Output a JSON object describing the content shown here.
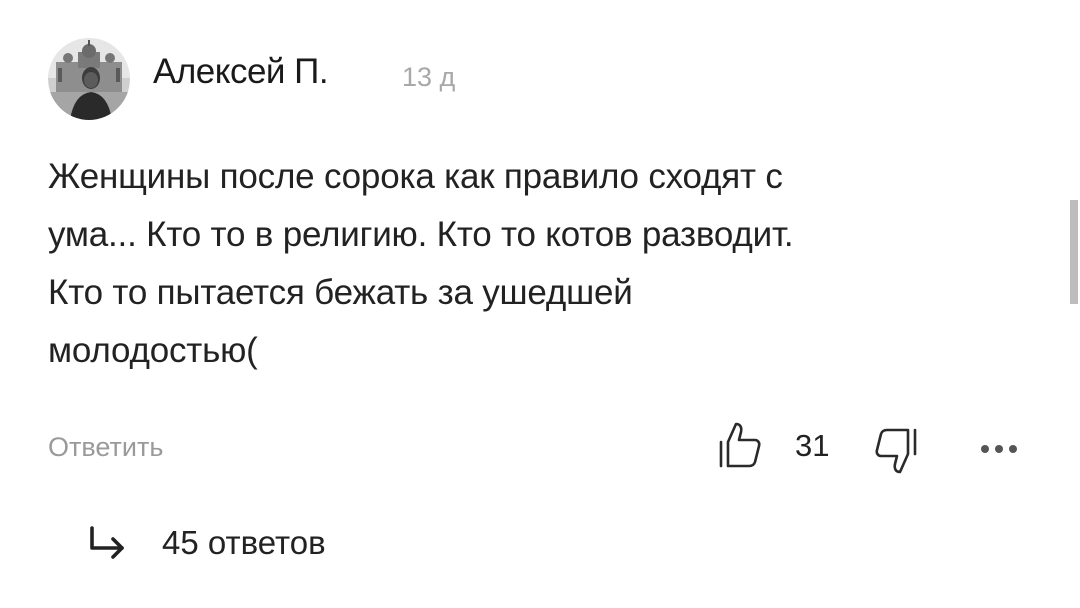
{
  "comment": {
    "author": "Алексей П.",
    "time": "13 д",
    "text_lines": [
      "Женщины после сорока как правило сходят с",
      "ума... Кто то в религию. Кто то котов разводит.",
      "Кто то пытается бежать за ушедшей",
      "молодостью("
    ],
    "reply_label": "Ответить",
    "likes": "31",
    "replies_label": "45 ответов"
  },
  "icons": {
    "avatar": "author-avatar",
    "like": "thumb-up-icon",
    "dislike": "thumb-down-icon",
    "more": "more-dots-icon",
    "replies": "reply-arrow-icon"
  },
  "colors": {
    "text": "#222222",
    "muted": "#9a9a9a",
    "background": "#ffffff"
  }
}
